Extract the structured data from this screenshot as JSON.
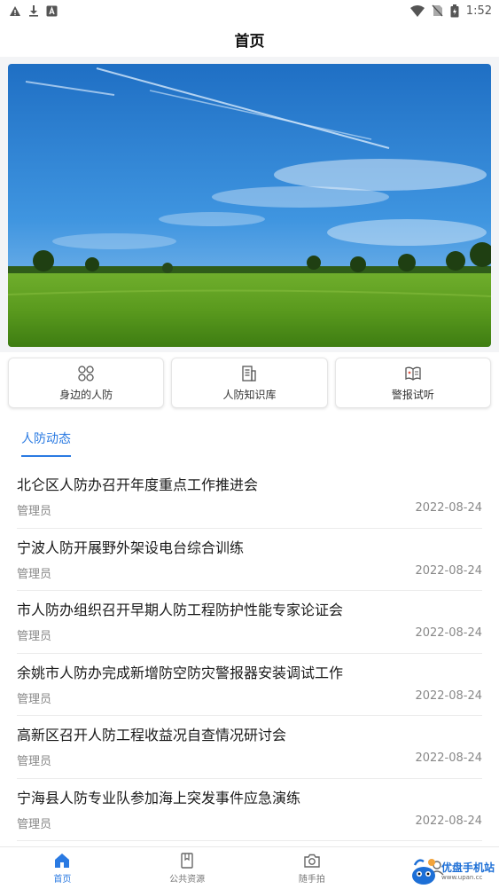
{
  "status_bar": {
    "time": "1:52"
  },
  "app_bar": {
    "title": "首页"
  },
  "quick_links": [
    {
      "label": "身边的人防",
      "icon": "grid-circles-icon"
    },
    {
      "label": "人防知识库",
      "icon": "document-list-icon"
    },
    {
      "label": "警报试听",
      "icon": "book-open-icon"
    }
  ],
  "section": {
    "tab_label": "人防动态"
  },
  "news": [
    {
      "title": "北仑区人防办召开年度重点工作推进会",
      "author": "管理员",
      "date": "2022-08-24"
    },
    {
      "title": "宁波人防开展野外架设电台综合训练",
      "author": "管理员",
      "date": "2022-08-24"
    },
    {
      "title": "市人防办组织召开早期人防工程防护性能专家论证会",
      "author": "管理员",
      "date": "2022-08-24"
    },
    {
      "title": "余姚市人防办完成新增防空防灾警报器安装调试工作",
      "author": "管理员",
      "date": "2022-08-24"
    },
    {
      "title": "高新区召开人防工程收益况自查情况研讨会",
      "author": "管理员",
      "date": "2022-08-24"
    },
    {
      "title": "宁海县人防专业队参加海上突发事件应急演练",
      "author": "管理员",
      "date": "2022-08-24"
    }
  ],
  "bottom_nav": [
    {
      "label": "首页",
      "icon": "home-icon",
      "active": true
    },
    {
      "label": "公共资源",
      "icon": "book-icon",
      "active": false
    },
    {
      "label": "随手拍",
      "icon": "camera-icon",
      "active": false
    },
    {
      "label": "",
      "icon": "user-icon",
      "active": false
    }
  ],
  "watermark": {
    "title": "优盘手机站",
    "url": "www.upan.cc"
  },
  "colors": {
    "accent": "#2a7ae2",
    "text": "#1a1a1a",
    "muted": "#888888"
  }
}
